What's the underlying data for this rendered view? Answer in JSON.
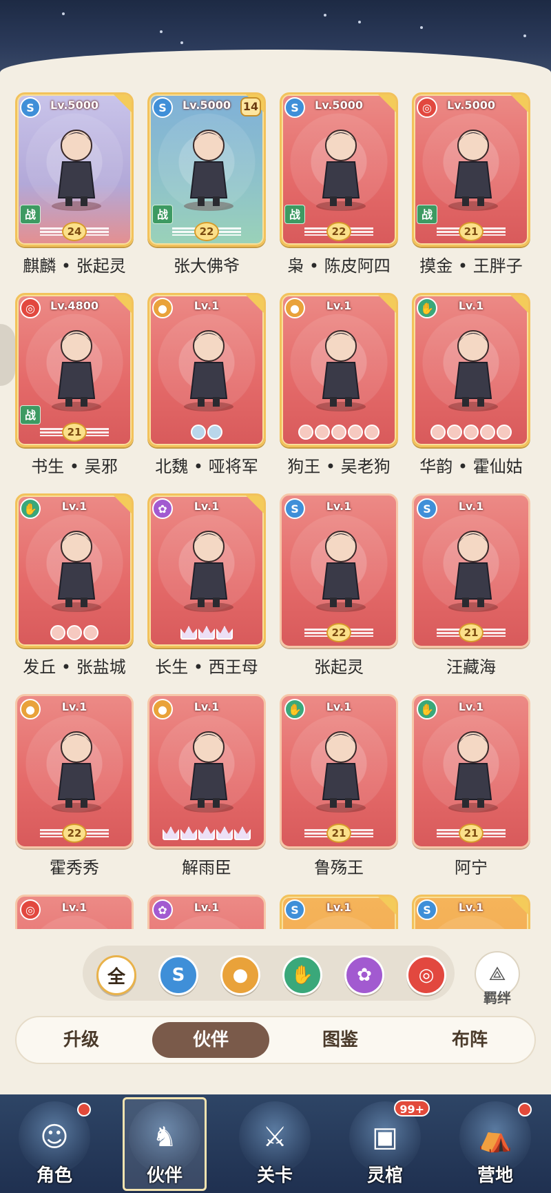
{
  "cards": [
    {
      "level": "Lv.5000",
      "name": "麒麟 • 张起灵",
      "faction": "dragon-icon",
      "faction_glyph": "S",
      "battle": "战",
      "badge_type": "wing",
      "badge_value": "24",
      "frame": "gold",
      "bg": "dragon"
    },
    {
      "level": "Lv.5000",
      "name": "张大佛爷",
      "faction": "dragon-icon",
      "faction_glyph": "S",
      "battle": "战",
      "badge_type": "wing",
      "badge_value": "22",
      "frame": "gold",
      "bg": "blue",
      "count": "14"
    },
    {
      "level": "Lv.5000",
      "name": "枭 • 陈皮阿四",
      "faction": "dragon-icon",
      "faction_glyph": "S",
      "battle": "战",
      "badge_type": "wing",
      "badge_value": "22",
      "frame": "gold",
      "bg": "red"
    },
    {
      "level": "Lv.5000",
      "name": "摸金 • 王胖子",
      "faction": "fire-icon",
      "faction_glyph": "◎",
      "battle": "战",
      "badge_type": "wing",
      "badge_value": "21",
      "frame": "gold",
      "bg": "red"
    },
    {
      "level": "Lv.4800",
      "name": "书生 • 吴邪",
      "faction": "fire-icon",
      "faction_glyph": "◎",
      "battle": "战",
      "badge_type": "wing",
      "badge_value": "21",
      "frame": "gold",
      "bg": "red"
    },
    {
      "level": "Lv.1",
      "name": "北魏 • 哑将军",
      "faction": "earth-icon",
      "faction_glyph": "●",
      "battle": "",
      "badge_type": "cloud",
      "badge_count": 2,
      "frame": "gold",
      "bg": "red"
    },
    {
      "level": "Lv.1",
      "name": "狗王 • 吴老狗",
      "faction": "earth-icon",
      "faction_glyph": "●",
      "battle": "",
      "badge_type": "moon",
      "badge_count": 5,
      "frame": "gold",
      "bg": "red"
    },
    {
      "level": "Lv.1",
      "name": "华韵 • 霍仙姑",
      "faction": "hand-icon",
      "faction_glyph": "✋",
      "battle": "",
      "badge_type": "moon",
      "badge_count": 5,
      "frame": "gold",
      "bg": "red"
    },
    {
      "level": "Lv.1",
      "name": "发丘 • 张盐城",
      "faction": "hand-icon",
      "faction_glyph": "✋",
      "battle": "",
      "badge_type": "moon",
      "badge_count": 3,
      "frame": "gold",
      "bg": "red"
    },
    {
      "level": "Lv.1",
      "name": "长生 • 西王母",
      "faction": "lotus-icon",
      "faction_glyph": "✿",
      "battle": "",
      "badge_type": "crown",
      "badge_count": 3,
      "frame": "gold",
      "bg": "red"
    },
    {
      "level": "Lv.1",
      "name": "张起灵",
      "faction": "dragon-icon",
      "faction_glyph": "S",
      "battle": "",
      "badge_type": "wing",
      "badge_value": "22",
      "frame": "plain",
      "bg": "red"
    },
    {
      "level": "Lv.1",
      "name": "汪藏海",
      "faction": "dragon-icon",
      "faction_glyph": "S",
      "battle": "",
      "badge_type": "wing",
      "badge_value": "21",
      "frame": "plain",
      "bg": "red"
    },
    {
      "level": "Lv.1",
      "name": "霍秀秀",
      "faction": "earth-icon",
      "faction_glyph": "●",
      "battle": "",
      "badge_type": "wing",
      "badge_value": "22",
      "frame": "plain",
      "bg": "red"
    },
    {
      "level": "Lv.1",
      "name": "解雨臣",
      "faction": "earth-icon",
      "faction_glyph": "●",
      "battle": "",
      "badge_type": "crown",
      "badge_count": 5,
      "frame": "plain",
      "bg": "red"
    },
    {
      "level": "Lv.1",
      "name": "鲁殇王",
      "faction": "hand-icon",
      "faction_glyph": "✋",
      "battle": "",
      "badge_type": "wing",
      "badge_value": "21",
      "frame": "plain",
      "bg": "red"
    },
    {
      "level": "Lv.1",
      "name": "阿宁",
      "faction": "hand-icon",
      "faction_glyph": "✋",
      "battle": "",
      "badge_type": "wing",
      "badge_value": "21",
      "frame": "plain",
      "bg": "red"
    },
    {
      "level": "Lv.1",
      "name": "",
      "faction": "fire-icon",
      "faction_glyph": "◎",
      "battle": "",
      "badge_type": "none",
      "frame": "plain",
      "bg": "red"
    },
    {
      "level": "Lv.1",
      "name": "",
      "faction": "lotus-icon",
      "faction_glyph": "✿",
      "battle": "",
      "badge_type": "none",
      "frame": "plain",
      "bg": "red"
    },
    {
      "level": "Lv.1",
      "name": "",
      "faction": "dragon-icon",
      "faction_glyph": "S",
      "battle": "",
      "badge_type": "none",
      "frame": "gold",
      "bg": "orange"
    },
    {
      "level": "Lv.1",
      "name": "",
      "faction": "dragon-icon",
      "faction_glyph": "S",
      "battle": "",
      "badge_type": "none",
      "frame": "gold",
      "bg": "orange"
    }
  ],
  "filters": {
    "all_label": "全",
    "items": [
      {
        "name": "dragon-icon",
        "glyph": "S",
        "color": "#3f8fd8"
      },
      {
        "name": "earth-icon",
        "glyph": "●",
        "color": "#e9a23a"
      },
      {
        "name": "hand-icon",
        "glyph": "✋",
        "color": "#3aa87a"
      },
      {
        "name": "lotus-icon",
        "glyph": "✿",
        "color": "#a25ad0"
      },
      {
        "name": "fire-icon",
        "glyph": "◎",
        "color": "#e2483f"
      }
    ],
    "bond_label": "羁绊"
  },
  "tabs": [
    {
      "label": "升级",
      "active": false
    },
    {
      "label": "伙伴",
      "active": true
    },
    {
      "label": "图鉴",
      "active": false
    },
    {
      "label": "布阵",
      "active": false
    }
  ],
  "nav": [
    {
      "label": "角色",
      "icon": "character-icon",
      "dot": true,
      "badge": ""
    },
    {
      "label": "伙伴",
      "icon": "partner-icon",
      "active": true,
      "dot": false,
      "badge": ""
    },
    {
      "label": "关卡",
      "icon": "stage-icon",
      "dot": false,
      "badge": ""
    },
    {
      "label": "灵棺",
      "icon": "coffin-icon",
      "dot": false,
      "badge": "99+"
    },
    {
      "label": "营地",
      "icon": "camp-icon",
      "dot": true,
      "badge": ""
    }
  ]
}
